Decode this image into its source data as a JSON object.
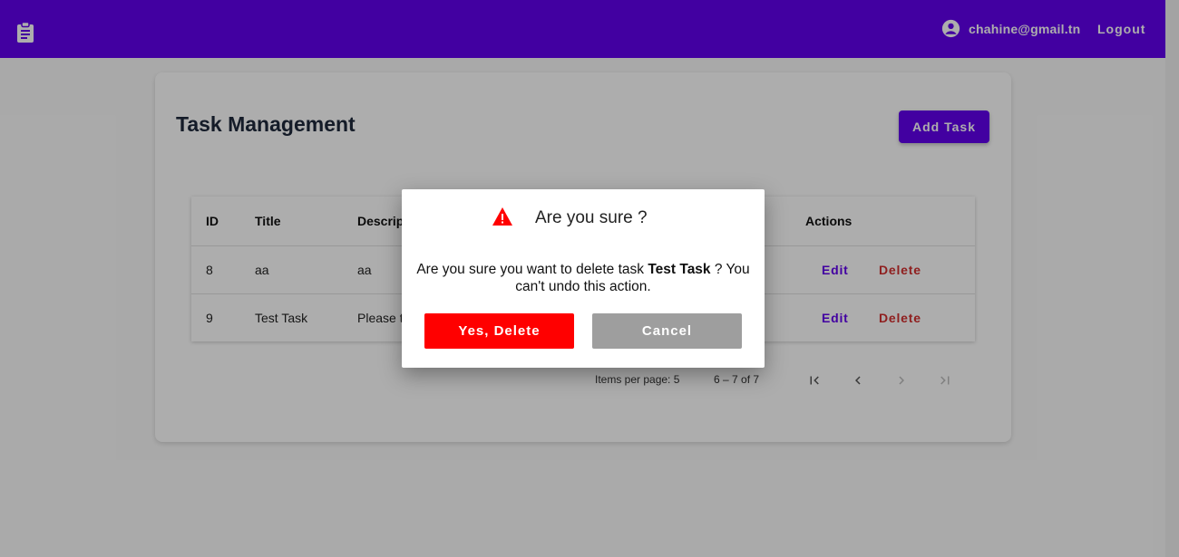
{
  "header": {
    "app_icon": "clipboard-icon",
    "user_icon": "account-circle-icon",
    "user_email": "chahine@gmail.tn",
    "logout_label": "Logout"
  },
  "main": {
    "title": "Task Management",
    "add_button_label": "Add Task",
    "table": {
      "columns": [
        "ID",
        "Title",
        "Descript",
        "Actions"
      ],
      "rows": [
        {
          "id": "8",
          "title": "aa",
          "description": "aa",
          "edit_label": "Edit",
          "delete_label": "Delete"
        },
        {
          "id": "9",
          "title": "Test Task",
          "description": "Please t",
          "edit_label": "Edit",
          "delete_label": "Delete"
        }
      ]
    },
    "paginator": {
      "items_per_page_label": "Items per page: 5",
      "range_label": "6 – 7 of 7",
      "first_icon": "first-page-icon",
      "prev_icon": "chevron-left-icon",
      "next_icon": "chevron-right-icon",
      "last_icon": "last-page-icon"
    }
  },
  "dialog": {
    "icon": "warning-icon",
    "title": "Are you sure ?",
    "message_prefix": "Are you sure you want to delete task ",
    "task_name": "Test Task",
    "message_suffix": " ? You can't undo this action.",
    "confirm_label": "Yes, Delete",
    "cancel_label": "Cancel"
  },
  "colors": {
    "primary": "#6200ee",
    "danger": "#ff0000",
    "delete_text": "#d32f2f",
    "cancel": "#9e9e9e"
  }
}
